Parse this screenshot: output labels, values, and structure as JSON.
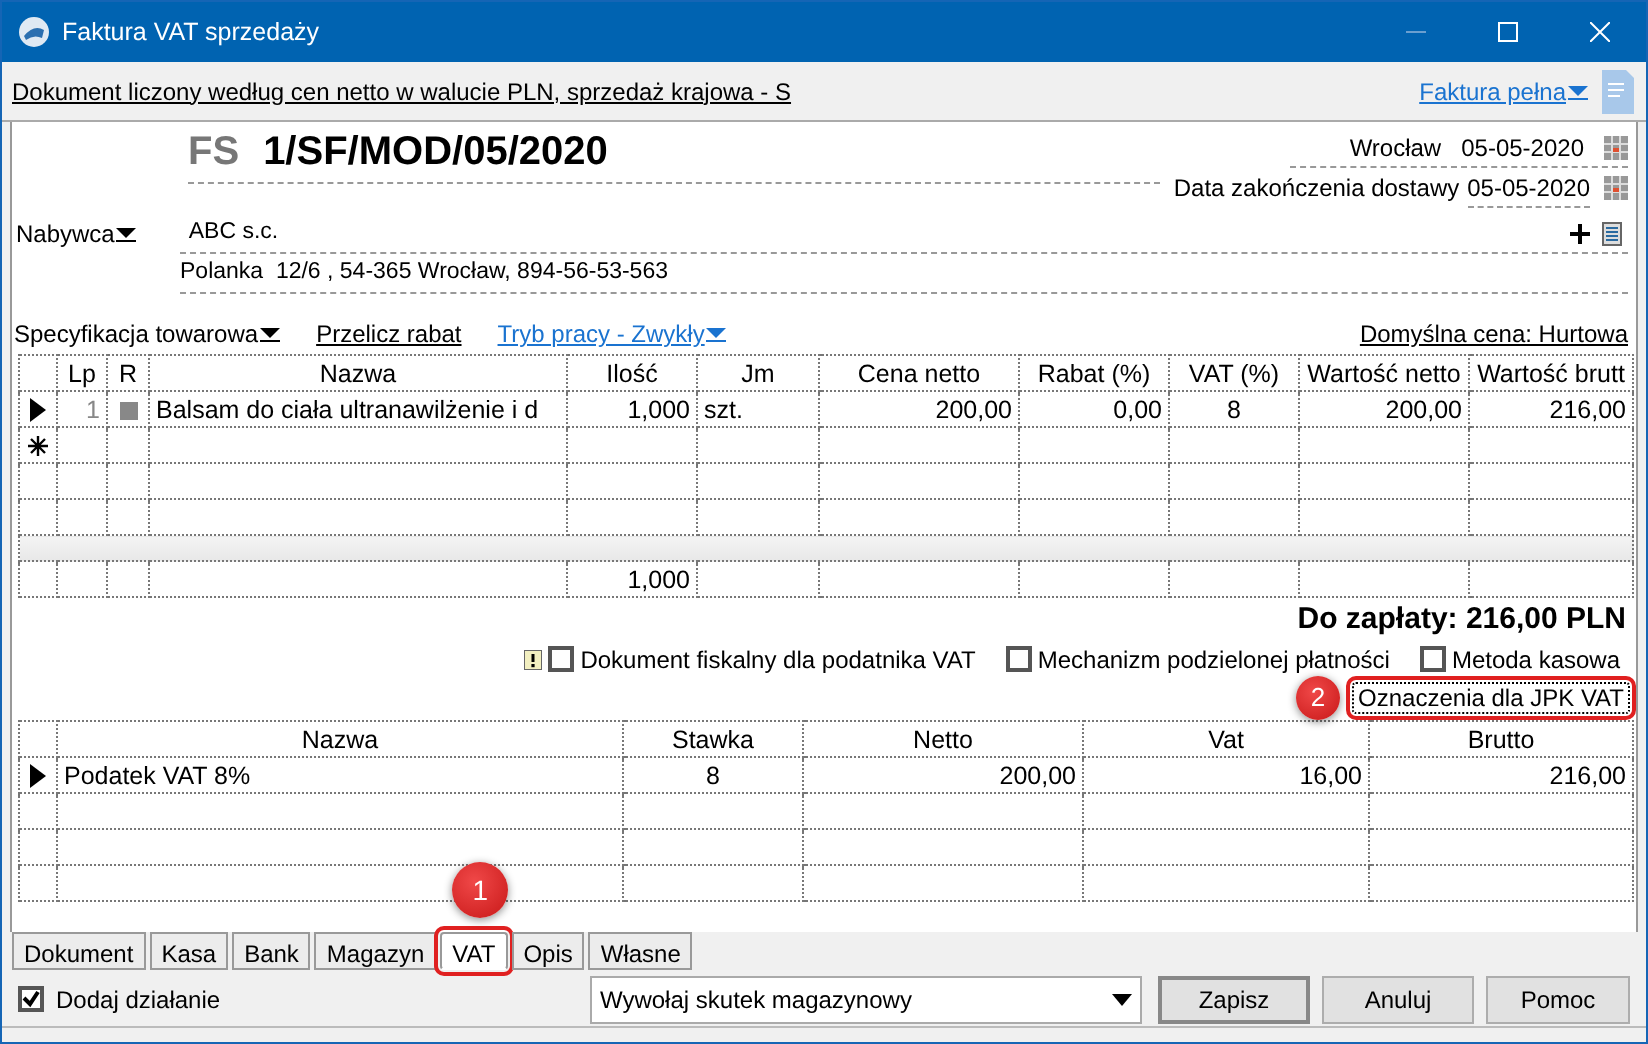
{
  "window": {
    "title": "Faktura VAT sprzedaży"
  },
  "info_bar": {
    "text": "Dokument liczony według cen netto w walucie PLN, sprzedaż krajowa - S",
    "document_type": "Faktura pełna"
  },
  "header": {
    "prefix": "FS",
    "number": "1/SF/MOD/05/2020",
    "place": "Wrocław",
    "issue_date": "05-05-2020",
    "delivery_label": "Data zakończenia dostawy",
    "delivery_date": "05-05-2020"
  },
  "buyer": {
    "label": "Nabywca",
    "name": "ABC s.c.",
    "address": "Polanka  12/6 , 54-365 Wrocław, 894-56-53-563"
  },
  "items_toolbar": {
    "specification": "Specyfikacja towarowa",
    "recalc": "Przelicz rabat",
    "mode": "Tryb pracy - Zwykły",
    "default_price": "Domyślna cena: Hurtowa"
  },
  "items_table": {
    "columns": [
      "Lp",
      "R",
      "Nazwa",
      "Ilość",
      "Jm",
      "Cena netto",
      "Rabat (%)",
      "VAT (%)",
      "Wartość netto",
      "Wartość brutt"
    ],
    "rows": [
      {
        "selected": true,
        "cells": [
          "1",
          null,
          "Balsam do ciała ultranawilżenie i d",
          "1,000",
          "szt.",
          "200,00",
          "0,00",
          "8",
          "200,00",
          "216,00"
        ]
      }
    ],
    "total_quantity": "1,000"
  },
  "amount_due": "Do zapłaty: 216,00 PLN",
  "options": [
    {
      "kind": "flagged",
      "label": "Dokument fiskalny dla podatnika VAT",
      "checked": false
    },
    {
      "kind": "plain",
      "label": "Mechanizm podzielonej płatności",
      "checked": false
    },
    {
      "kind": "plain",
      "label": "Metoda kasowa",
      "checked": false
    }
  ],
  "jpk_button": {
    "label": "Oznaczenia dla JPK VAT",
    "highlighted": true,
    "callout": "2"
  },
  "vat_table": {
    "columns": [
      "Nazwa",
      "Stawka",
      "Netto",
      "Vat",
      "Brutto"
    ],
    "rows": [
      {
        "selected": true,
        "cells": [
          "Podatek VAT 8%",
          "8",
          "200,00",
          "16,00",
          "216,00"
        ]
      }
    ]
  },
  "tabs": [
    {
      "label": "Dokument",
      "selected": false,
      "highlighted": false
    },
    {
      "label": "Kasa",
      "selected": false,
      "highlighted": false
    },
    {
      "label": "Bank",
      "selected": false,
      "highlighted": false
    },
    {
      "label": "Magazyn",
      "selected": false,
      "highlighted": false
    },
    {
      "label": "VAT",
      "selected": true,
      "highlighted": true,
      "callout": "1"
    },
    {
      "label": "Opis",
      "selected": false,
      "highlighted": false
    },
    {
      "label": "Własne",
      "selected": false,
      "highlighted": false
    }
  ],
  "footer": {
    "add_action": {
      "label": "Dodaj działanie",
      "checked": true
    },
    "stock_action": "Wywołaj skutek magazynowy",
    "buttons": [
      "Zapisz",
      "Anuluj",
      "Pomoc"
    ]
  }
}
